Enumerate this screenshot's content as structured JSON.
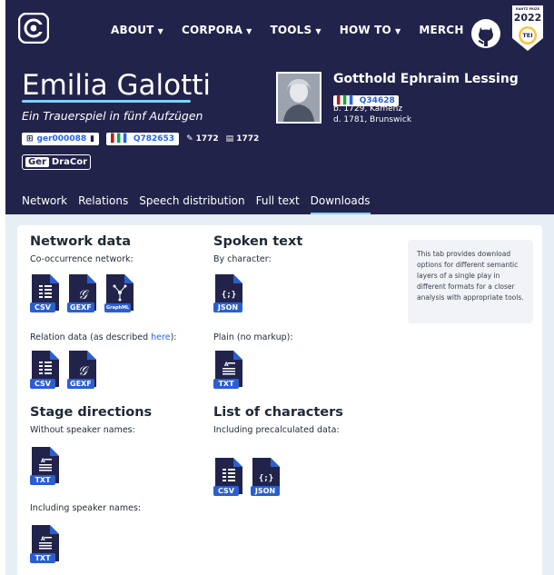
{
  "nav": {
    "items": [
      {
        "label": "ABOUT",
        "dropdown": true
      },
      {
        "label": "CORPORA",
        "dropdown": true
      },
      {
        "label": "TOOLS",
        "dropdown": true
      },
      {
        "label": "HOW TO",
        "dropdown": true
      },
      {
        "label": "MERCH",
        "dropdown": false
      }
    ],
    "badge_year": "2022",
    "badge_text": "TEI",
    "badge_top": "RAHTZ PRIZE"
  },
  "play": {
    "title": "Emilia Galotti",
    "subtitle": "Ein Trauerspiel in fünf Aufzügen",
    "id": "ger000088",
    "wikidata": "Q782653",
    "written": "1772",
    "printed": "1772",
    "corpus_code": "Ger",
    "corpus_name": "DraCor"
  },
  "author": {
    "name": "Gotthold Ephraim Lessing",
    "wikidata": "Q34628",
    "born": "b. 1729, Kamenz",
    "died": "d. 1781, Brunswick"
  },
  "tabs": [
    "Network",
    "Relations",
    "Speech distribution",
    "Full text",
    "Downloads"
  ],
  "active_tab": "Downloads",
  "downloads": {
    "network": {
      "title": "Network data",
      "cooccurrence_label": "Co-occurrence network:",
      "cooccurrence_files": [
        "CSV",
        "GEXF",
        "GraphML"
      ],
      "relation_label_prefix": "Relation data (as described ",
      "relation_link": "here",
      "relation_label_suffix": "):",
      "relation_files": [
        "CSV",
        "GEXF"
      ]
    },
    "spoken": {
      "title": "Spoken text",
      "by_character_label": "By character:",
      "by_character_files": [
        "JSON"
      ],
      "plain_label": "Plain (no markup):",
      "plain_files": [
        "TXT"
      ]
    },
    "stage": {
      "title": "Stage directions",
      "without_label": "Without speaker names:",
      "without_files": [
        "TXT"
      ],
      "including_label": "Including speaker names:",
      "including_files": [
        "TXT"
      ]
    },
    "characters": {
      "title": "List of characters",
      "label": "Including precalculated data:",
      "files": [
        "CSV",
        "JSON"
      ]
    },
    "info": "This tab provides download options for different semantic layers of a single play in different formats for a closer analysis with appropriate tools."
  },
  "colors": {
    "header_bg": "#22234a",
    "accent": "#7dd3fc",
    "badge": "#2b5fcf",
    "content_bg": "#e8eef6"
  }
}
